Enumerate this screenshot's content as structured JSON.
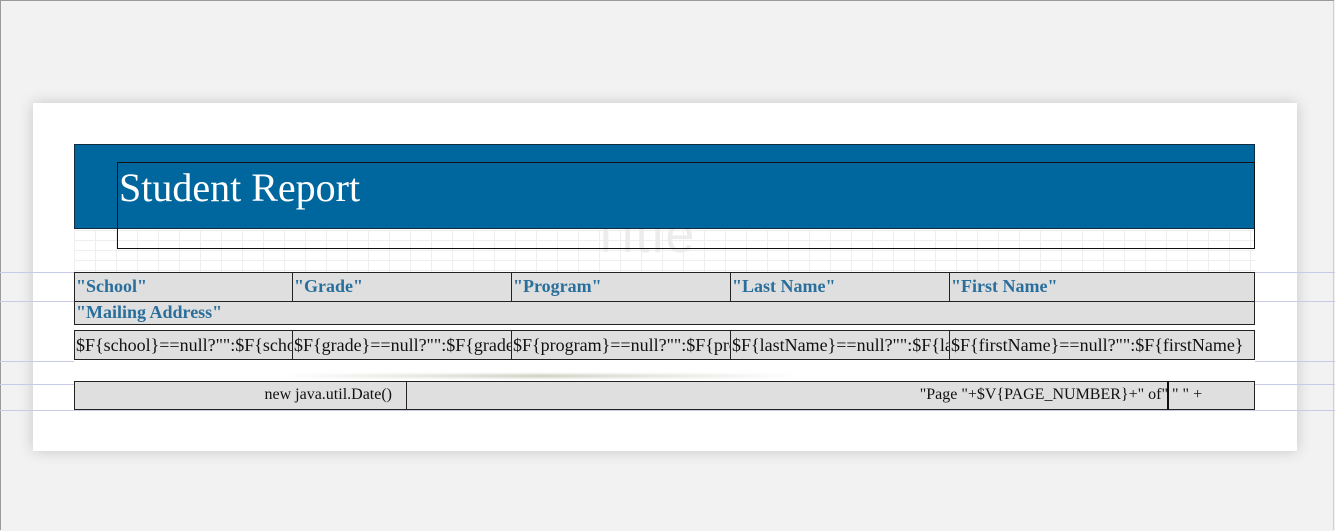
{
  "report": {
    "title": "Student Report",
    "watermark": "Title"
  },
  "column_headers": [
    "\"School\"",
    "\"Grade\"",
    "\"Program\"",
    "\"Last Name\"",
    "\"First Name\""
  ],
  "mailing_header": "\"Mailing Address\"",
  "detail_fields": [
    "$F{school}==null?\"\":$F{school}",
    "$F{grade}==null?\"\":$F{grade}",
    "$F{program}==null?\"\":$F{program}",
    "$F{lastName}==null?\"\":$F{lastName}",
    "$F{firstName}==null?\"\":$F{firstName}"
  ],
  "footer": {
    "date_expr": "new java.util.Date()",
    "page_expr": "\"Page \"+$V{PAGE_NUMBER}+\" of\"",
    "page_total_expr": "\" \" +"
  },
  "colors": {
    "title_band": "#00679e",
    "header_text": "#2a6f9c",
    "cell_bg": "#dfdfdf"
  }
}
